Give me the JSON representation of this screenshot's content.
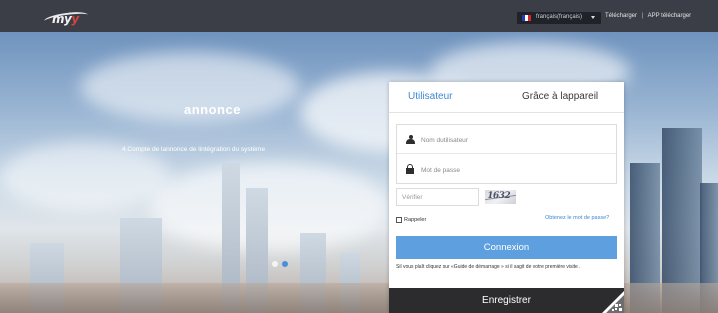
{
  "header": {
    "logo": {
      "text_main": "my",
      "text_accent": "y"
    },
    "language": {
      "selected": "français(français)",
      "flag_colors": [
        "#1f3fb0",
        "#ffffff",
        "#d9262c"
      ]
    },
    "links": {
      "download": "Télécharger",
      "separator": "|",
      "app_download": "APP télécharger"
    }
  },
  "announcement": {
    "title": "annonce",
    "text": "4.Compte de lannonce de lintégration du système",
    "carousel_active": 2,
    "carousel_total": 2
  },
  "login": {
    "tabs": {
      "user": "Utilisateur",
      "device": "Grâce à lappareil"
    },
    "username_placeholder": "Nom dutilisateur",
    "password_placeholder": "Mot de passe",
    "verify_placeholder": "Vérifier",
    "captcha_text": "1632",
    "remember_label": "Rappeler",
    "forgot_link": "Obtenez le mot de passe?",
    "login_button": "Connexion",
    "hint": "Sil vous plaît cliquez sur «Guide de démarrage » si il sagit de votre première visite .",
    "register_button": "Enregistrer"
  },
  "colors": {
    "topbar": "#3b3e47",
    "accent": "#3c88d6",
    "login_button": "#5e9fdf",
    "register_bar": "#2c2c2e"
  }
}
